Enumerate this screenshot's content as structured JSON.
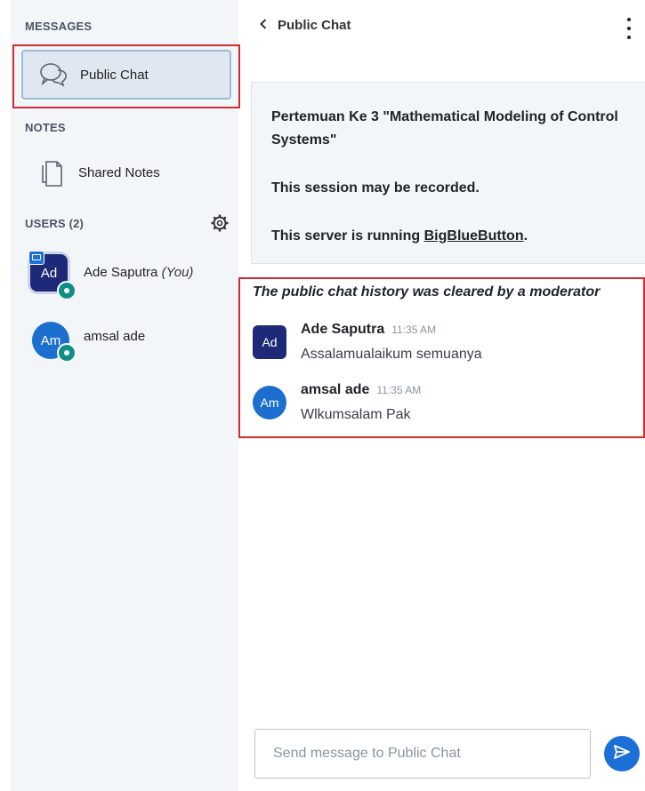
{
  "sidebar": {
    "messages_title": "MESSAGES",
    "public_chat_label": "Public Chat",
    "notes_title": "NOTES",
    "shared_notes_label": "Shared Notes",
    "users_title": "USERS (2)",
    "users": [
      {
        "initials": "Ad",
        "name": "Ade Saputra",
        "you_tag": "(You)",
        "avatar_color": "#1e2a78"
      },
      {
        "initials": "Am",
        "name": "amsal ade",
        "avatar_color": "#1c6fcf"
      }
    ]
  },
  "chat": {
    "header_title": "Public Chat",
    "welcome": {
      "line1": "Pertemuan Ke 3 \"Mathematical Modeling of Control Systems\"",
      "line2": "This session may be recorded.",
      "line3_prefix": "This server is running ",
      "line3_link": "BigBlueButton",
      "line3_suffix": "."
    },
    "cleared_notice": "The public chat history was cleared by a moderator",
    "messages": [
      {
        "initials": "Ad",
        "sender": "Ade Saputra",
        "time": "11:35 AM",
        "text": "Assalamualaikum semuanya",
        "avatar_color": "#1e2a78"
      },
      {
        "initials": "Am",
        "sender": "amsal ade",
        "time": "11:35 AM",
        "text": "Wlkumsalam Pak",
        "avatar_color": "#1c6fcf"
      }
    ],
    "input_placeholder": "Send message to Public Chat"
  },
  "colors": {
    "accent": "#1b6fd6",
    "highlight_box": "#d12a32",
    "moderator_badge": "#0d8f84"
  }
}
